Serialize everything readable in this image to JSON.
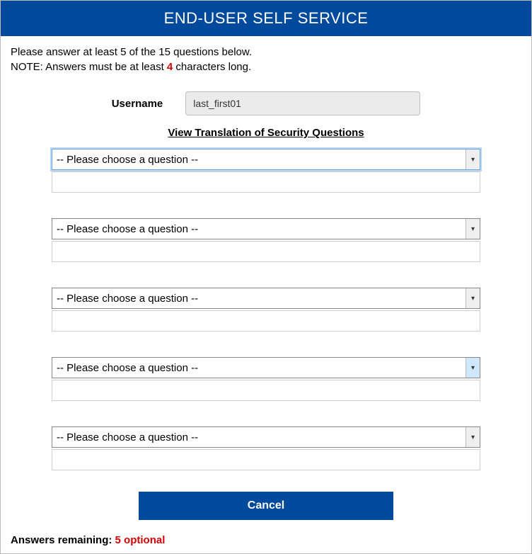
{
  "title": "END-USER SELF SERVICE",
  "instructions": {
    "line1": "Please answer at least 5 of the 15 questions below.",
    "line2_pre": "NOTE: Answers must be at least ",
    "min_chars": "4",
    "line2_post": " characters long."
  },
  "username": {
    "label": "Username",
    "value": "last_first01"
  },
  "translate_link": "View Translation of Security Questions",
  "questions": {
    "placeholder": "-- Please choose a question --",
    "items": [
      {
        "selected": "-- Please choose a question --",
        "answer": "",
        "focused": true,
        "hovered": false
      },
      {
        "selected": "-- Please choose a question --",
        "answer": "",
        "focused": false,
        "hovered": false
      },
      {
        "selected": "-- Please choose a question --",
        "answer": "",
        "focused": false,
        "hovered": false
      },
      {
        "selected": "-- Please choose a question --",
        "answer": "",
        "focused": false,
        "hovered": true
      },
      {
        "selected": "-- Please choose a question --",
        "answer": "",
        "focused": false,
        "hovered": false
      }
    ]
  },
  "cancel_label": "Cancel",
  "remaining": {
    "label": "Answers remaining: ",
    "value": "5 optional"
  }
}
